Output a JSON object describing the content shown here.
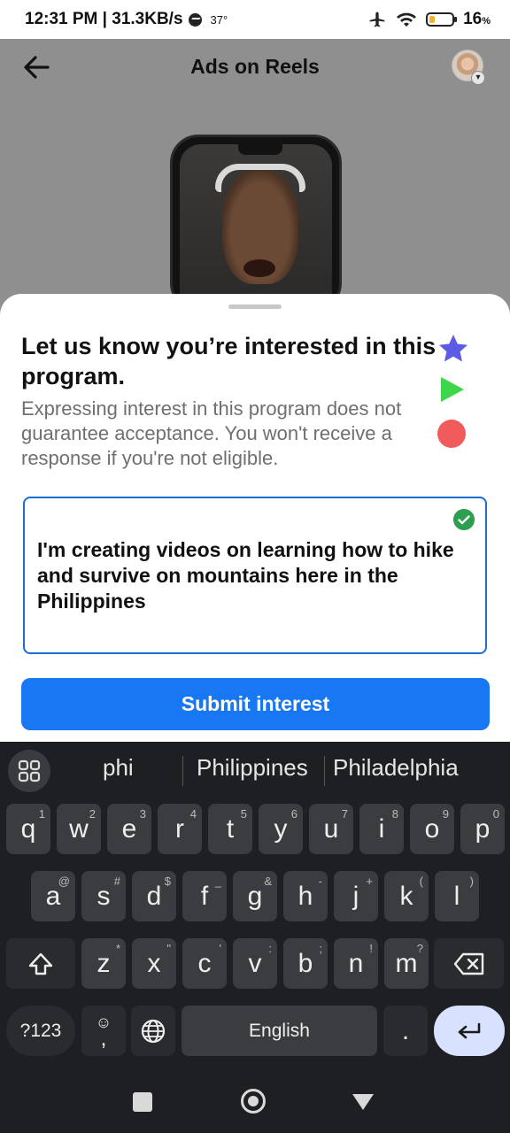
{
  "status_bar": {
    "time_speed": "12:31 PM | 31.3KB/s",
    "temperature": "37°",
    "battery_pct": "16",
    "battery_unit": "%"
  },
  "header": {
    "title": "Ads on Reels",
    "back_icon": "arrow-left-icon",
    "avatar_icon": "profile-avatar"
  },
  "sheet": {
    "title": "Let us know you’re interested in this program.",
    "description": "Expressing interest in this program does not guarantee acceptance. You won't receive a response if you're not eligible.",
    "input_value": "I'm creating videos on learning how to hike and survive on mountains here in the Philippines",
    "submit_label": "Submit interest",
    "accent_color": "#1877f2"
  },
  "keyboard": {
    "suggestions": [
      "phi",
      "Philippines",
      "Philadelphia"
    ],
    "row1": [
      {
        "k": "q",
        "h": "1"
      },
      {
        "k": "w",
        "h": "2"
      },
      {
        "k": "e",
        "h": "3"
      },
      {
        "k": "r",
        "h": "4"
      },
      {
        "k": "t",
        "h": "5"
      },
      {
        "k": "y",
        "h": "6"
      },
      {
        "k": "u",
        "h": "7"
      },
      {
        "k": "i",
        "h": "8"
      },
      {
        "k": "o",
        "h": "9"
      },
      {
        "k": "p",
        "h": "0"
      }
    ],
    "row2": [
      {
        "k": "a",
        "h": "@"
      },
      {
        "k": "s",
        "h": "#"
      },
      {
        "k": "d",
        "h": "$"
      },
      {
        "k": "f",
        "h": "_"
      },
      {
        "k": "g",
        "h": "&"
      },
      {
        "k": "h",
        "h": "-"
      },
      {
        "k": "j",
        "h": "+"
      },
      {
        "k": "k",
        "h": "("
      },
      {
        "k": "l",
        "h": ")"
      }
    ],
    "row3": [
      {
        "k": "z",
        "h": "*"
      },
      {
        "k": "x",
        "h": "\""
      },
      {
        "k": "c",
        "h": "'"
      },
      {
        "k": "v",
        "h": ":"
      },
      {
        "k": "b",
        "h": ";"
      },
      {
        "k": "n",
        "h": "!"
      },
      {
        "k": "m",
        "h": "?"
      }
    ],
    "symbols_label": "?123",
    "emoji_comma_label": ",",
    "space_label": "English",
    "period_label": "."
  }
}
